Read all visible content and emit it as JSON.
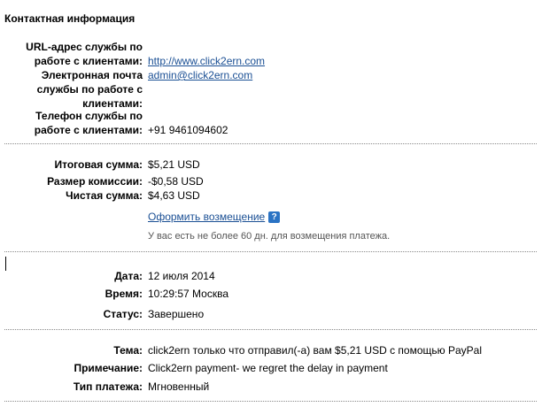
{
  "contact": {
    "title": "Контактная информация",
    "url_label": "URL-адрес службы по работе с клиентами:",
    "url_value": "http://www.click2ern.com",
    "email_label": "Электронная почта службы по работе с клиентами:",
    "email_value": "admin@click2ern.com",
    "phone_label": "Телефон службы по работе с клиентами:",
    "phone_value": "+91 9461094602"
  },
  "amounts": {
    "gross_label": "Итоговая сумма:",
    "gross_value": "$5,21 USD",
    "fee_label": "Размер комиссии:",
    "fee_value": "-$0,58 USD",
    "net_label": "Чистая сумма:",
    "net_value": "$4,63 USD",
    "refund_link": "Оформить возмещение",
    "help_icon": "?",
    "refund_note": "У вас есть не более 60 дн. для возмещения платежа."
  },
  "details": {
    "date_label": "Дата:",
    "date_value": "12 июля 2014",
    "time_label": "Время:",
    "time_value": "10:29:57 Москва",
    "status_label": "Статус:",
    "status_value": "Завершено"
  },
  "message": {
    "subject_label": "Тема:",
    "subject_value": "click2ern только что отправил(-а) вам $5,21 USD с помощью PayPal",
    "note_label": "Примечание:",
    "note_value": "Click2ern payment- we regret the delay in payment",
    "type_label": "Тип платежа:",
    "type_value": "Мгновенный"
  }
}
